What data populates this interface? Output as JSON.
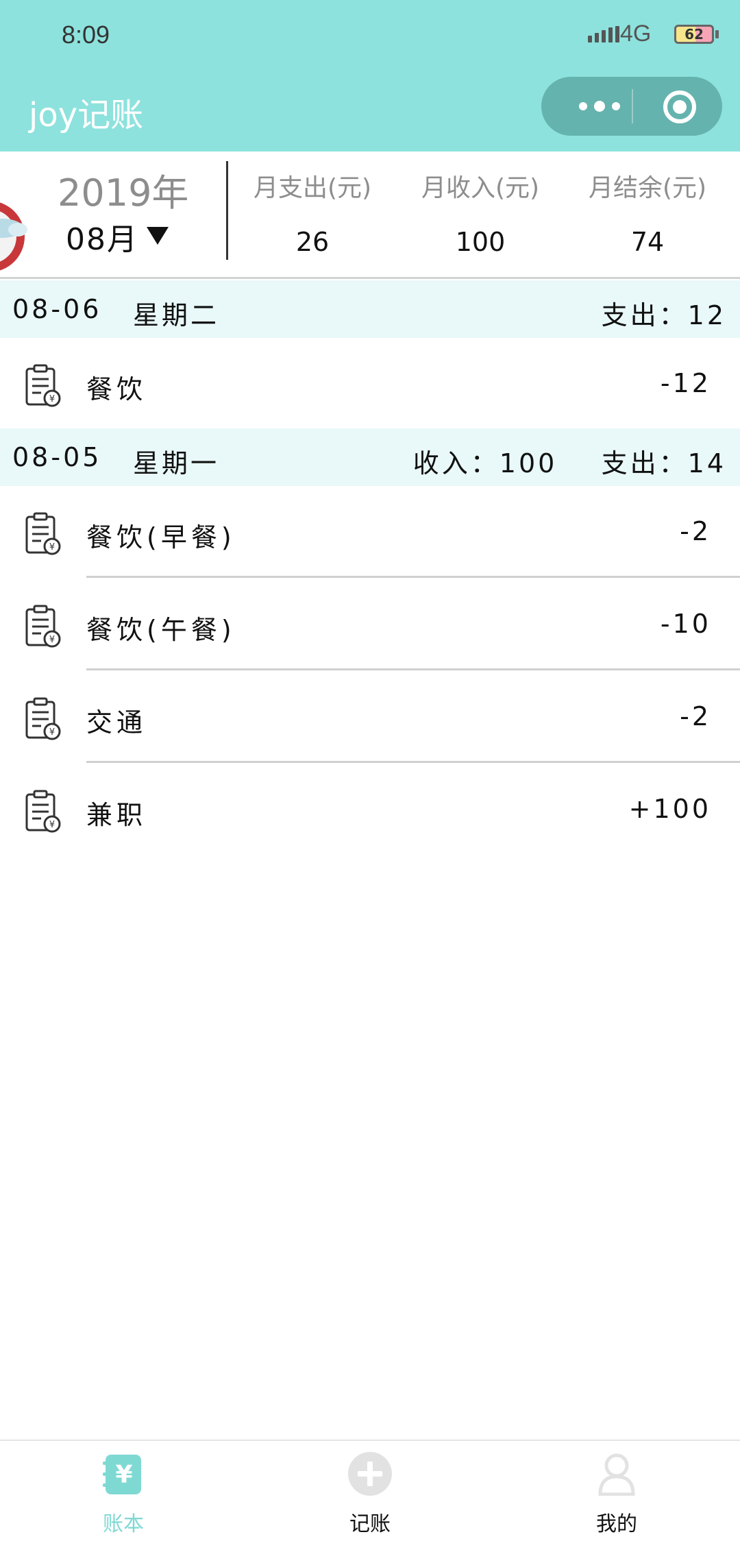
{
  "status_bar": {
    "time": "8:09",
    "network": "4G",
    "battery": "62"
  },
  "nav": {
    "title": "joy记账"
  },
  "summary": {
    "year": "2019年",
    "month": "08月",
    "stats": [
      {
        "label": "月支出(元)",
        "value": "26"
      },
      {
        "label": "月收入(元)",
        "value": "100"
      },
      {
        "label": "月结余(元)",
        "value": "74"
      }
    ]
  },
  "days": [
    {
      "date": "08-06",
      "weekday": "星期二",
      "totals": "支出：12",
      "entries": [
        {
          "name": "餐饮",
          "amount": "-12"
        }
      ]
    },
    {
      "date": "08-05",
      "weekday": "星期一",
      "totals": "收入：100    支出：14",
      "entries": [
        {
          "name": "餐饮(早餐)",
          "amount": "-2"
        },
        {
          "name": "餐饮(午餐)",
          "amount": "-10"
        },
        {
          "name": "交通",
          "amount": "-2"
        },
        {
          "name": "兼职",
          "amount": "+100"
        }
      ]
    }
  ],
  "tabbar": {
    "tabs": [
      {
        "label": "账本",
        "active": true
      },
      {
        "label": "记账",
        "active": false
      },
      {
        "label": "我的",
        "active": false
      }
    ]
  },
  "colors": {
    "header_bg": "#8de2dd",
    "accent": "#7fd9d3",
    "day_header_bg": "#e9f8f8",
    "inactive_icon": "#e2e2e2"
  },
  "icons": {
    "entry": "receipt-yen-icon",
    "tab_ledger": "yen-note-icon",
    "tab_add": "plus-circle-icon",
    "tab_me": "person-icon"
  }
}
